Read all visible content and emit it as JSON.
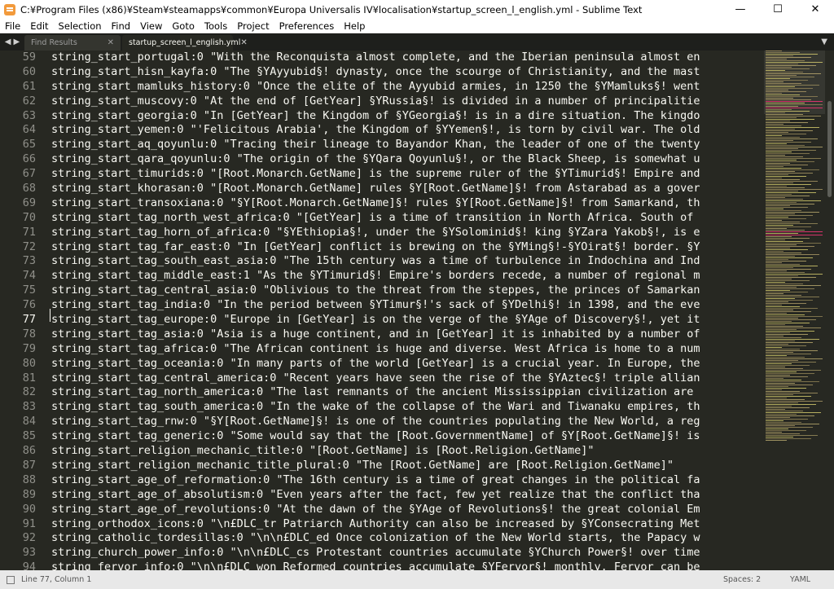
{
  "window": {
    "title": "C:¥Program Files (x86)¥Steam¥steamapps¥common¥Europa Universalis IV¥localisation¥startup_screen_l_english.yml - Sublime Text",
    "minimize": "—",
    "maximize": "☐",
    "close": "✕"
  },
  "menu": [
    "File",
    "Edit",
    "Selection",
    "Find",
    "View",
    "Goto",
    "Tools",
    "Project",
    "Preferences",
    "Help"
  ],
  "tabs": [
    {
      "label": "Find Results",
      "active": false
    },
    {
      "label": "startup_screen_l_english.yml",
      "active": true
    }
  ],
  "editor": {
    "current_line": 77,
    "lines": [
      {
        "num": "59",
        "text": "string_start_portugal:0 \"With the Reconquista almost complete, and the Iberian peninsula almost en"
      },
      {
        "num": "60",
        "text": "string_start_hisn_kayfa:0 \"The §YAyyubid§! dynasty, once the scourge of Christianity, and the mast"
      },
      {
        "num": "61",
        "text": "string_start_mamluks_history:0 \"Once the elite of the Ayyubid armies, in 1250 the §YMamluks§! went"
      },
      {
        "num": "62",
        "text": "string_start_muscovy:0 \"At the end of [GetYear] §YRussia§! is divided in a number of principalitie"
      },
      {
        "num": "63",
        "text": "string_start_georgia:0 \"In [GetYear] the Kingdom of §YGeorgia§! is in a dire situation. The kingdo"
      },
      {
        "num": "64",
        "text": "string_start_yemen:0 \"'Felicitous Arabia', the Kingdom of §YYemen§!, is torn by civil war. The old"
      },
      {
        "num": "65",
        "text": "string_start_aq_qoyunlu:0 \"Tracing their lineage to Bayandor Khan, the leader of one of the twenty"
      },
      {
        "num": "66",
        "text": "string_start_qara_qoyunlu:0 \"The origin of the §YQara Qoyunlu§!, or the Black Sheep, is somewhat u"
      },
      {
        "num": "67",
        "text": "string_start_timurids:0 \"[Root.Monarch.GetName] is the supreme ruler of the §YTimurid§! Empire and"
      },
      {
        "num": "68",
        "text": "string_start_khorasan:0 \"[Root.Monarch.GetName] rules §Y[Root.GetName]§! from Astarabad as a gover"
      },
      {
        "num": "69",
        "text": "string_start_transoxiana:0 \"§Y[Root.Monarch.GetName]§! rules §Y[Root.GetName]§! from Samarkand, th"
      },
      {
        "num": "70",
        "text": "string_start_tag_north_west_africa:0 \"[GetYear] is a time of transition in North Africa. South of"
      },
      {
        "num": "71",
        "text": "string_start_tag_horn_of_africa:0 \"§YEthiopia§!, under the §YSolominid§! king §YZara Yakob§!, is e"
      },
      {
        "num": "72",
        "text": "string_start_tag_far_east:0 \"In [GetYear] conflict is brewing on the §YMing§!-§YOirat§! border. §Y"
      },
      {
        "num": "73",
        "text": "string_start_tag_south_east_asia:0 \"The 15th century was a time of turbulence in Indochina and Ind"
      },
      {
        "num": "74",
        "text": "string_start_tag_middle_east:1 \"As the §YTimurid§! Empire's borders recede, a number of regional m"
      },
      {
        "num": "75",
        "text": "string_start_tag_central_asia:0 \"Oblivious to the threat from the steppes, the princes of Samarkan"
      },
      {
        "num": "76",
        "text": "string_start_tag_india:0 \"In the period between §YTimur§!'s sack of §YDelhi§! in 1398, and the eve"
      },
      {
        "num": "77",
        "text": "string_start_tag_europe:0 \"Europe in [GetYear] is on the verge of the §YAge of Discovery§!, yet it"
      },
      {
        "num": "78",
        "text": "string_start_tag_asia:0 \"Asia is a huge continent, and in [GetYear] it is inhabited by a number of"
      },
      {
        "num": "79",
        "text": "string_start_tag_africa:0 \"The African continent is huge and diverse. West Africa is home to a num"
      },
      {
        "num": "80",
        "text": "string_start_tag_oceania:0 \"In many parts of the world [GetYear] is a crucial year. In Europe, the"
      },
      {
        "num": "81",
        "text": "string_start_tag_central_america:0 \"Recent years have seen the rise of the §YAztec§! triple allian"
      },
      {
        "num": "82",
        "text": "string_start_tag_north_america:0 \"The last remnants of the ancient Mississippian civilization are"
      },
      {
        "num": "83",
        "text": "string_start_tag_south_america:0 \"In the wake of the collapse of the Wari and Tiwanaku empires, th"
      },
      {
        "num": "84",
        "text": "string_start_tag_rnw:0 \"§Y[Root.GetName]§! is one of the countries populating the New World, a reg"
      },
      {
        "num": "85",
        "text": "string_start_tag_generic:0 \"Some would say that the [Root.GovernmentName] of §Y[Root.GetName]§! is"
      },
      {
        "num": "86",
        "text": "string_start_religion_mechanic_title:0 \"[Root.GetName] is [Root.Religion.GetName]\""
      },
      {
        "num": "87",
        "text": "string_start_religion_mechanic_title_plural:0 \"The [Root.GetName] are [Root.Religion.GetName]\""
      },
      {
        "num": "88",
        "text": "string_start_age_of_reformation:0 \"The 16th century is a time of great changes in the political fa"
      },
      {
        "num": "89",
        "text": "string_start_age_of_absolutism:0 \"Even years after the fact, few yet realize that the conflict tha"
      },
      {
        "num": "90",
        "text": "string_start_age_of_revolutions:0 \"At the dawn of the §YAge of Revolutions§! the great colonial Em"
      },
      {
        "num": "91",
        "text": "string_orthodox_icons:0 \"\\n£DLC_tr Patriarch Authority can also be increased by §YConsecrating Met"
      },
      {
        "num": "92",
        "text": "string_catholic_tordesillas:0 \"\\n\\n£DLC_ed Once colonization of the New World starts, the Papacy w"
      },
      {
        "num": "93",
        "text": "string_church_power_info:0 \"\\n\\n£DLC_cs Protestant countries accumulate §YChurch Power§! over time"
      },
      {
        "num": "94",
        "text": "string_fervor_info:0 \"\\n\\n£DLC_won Reformed countries accumulate §YFervor§! monthly. Fervor can be"
      }
    ]
  },
  "colors": {
    "background": "#272822",
    "text": "#f8f8f2",
    "line_number": "#90908a"
  },
  "status": {
    "position": "Line 77, Column 1",
    "spaces": "Spaces: 2",
    "syntax": "YAML"
  }
}
